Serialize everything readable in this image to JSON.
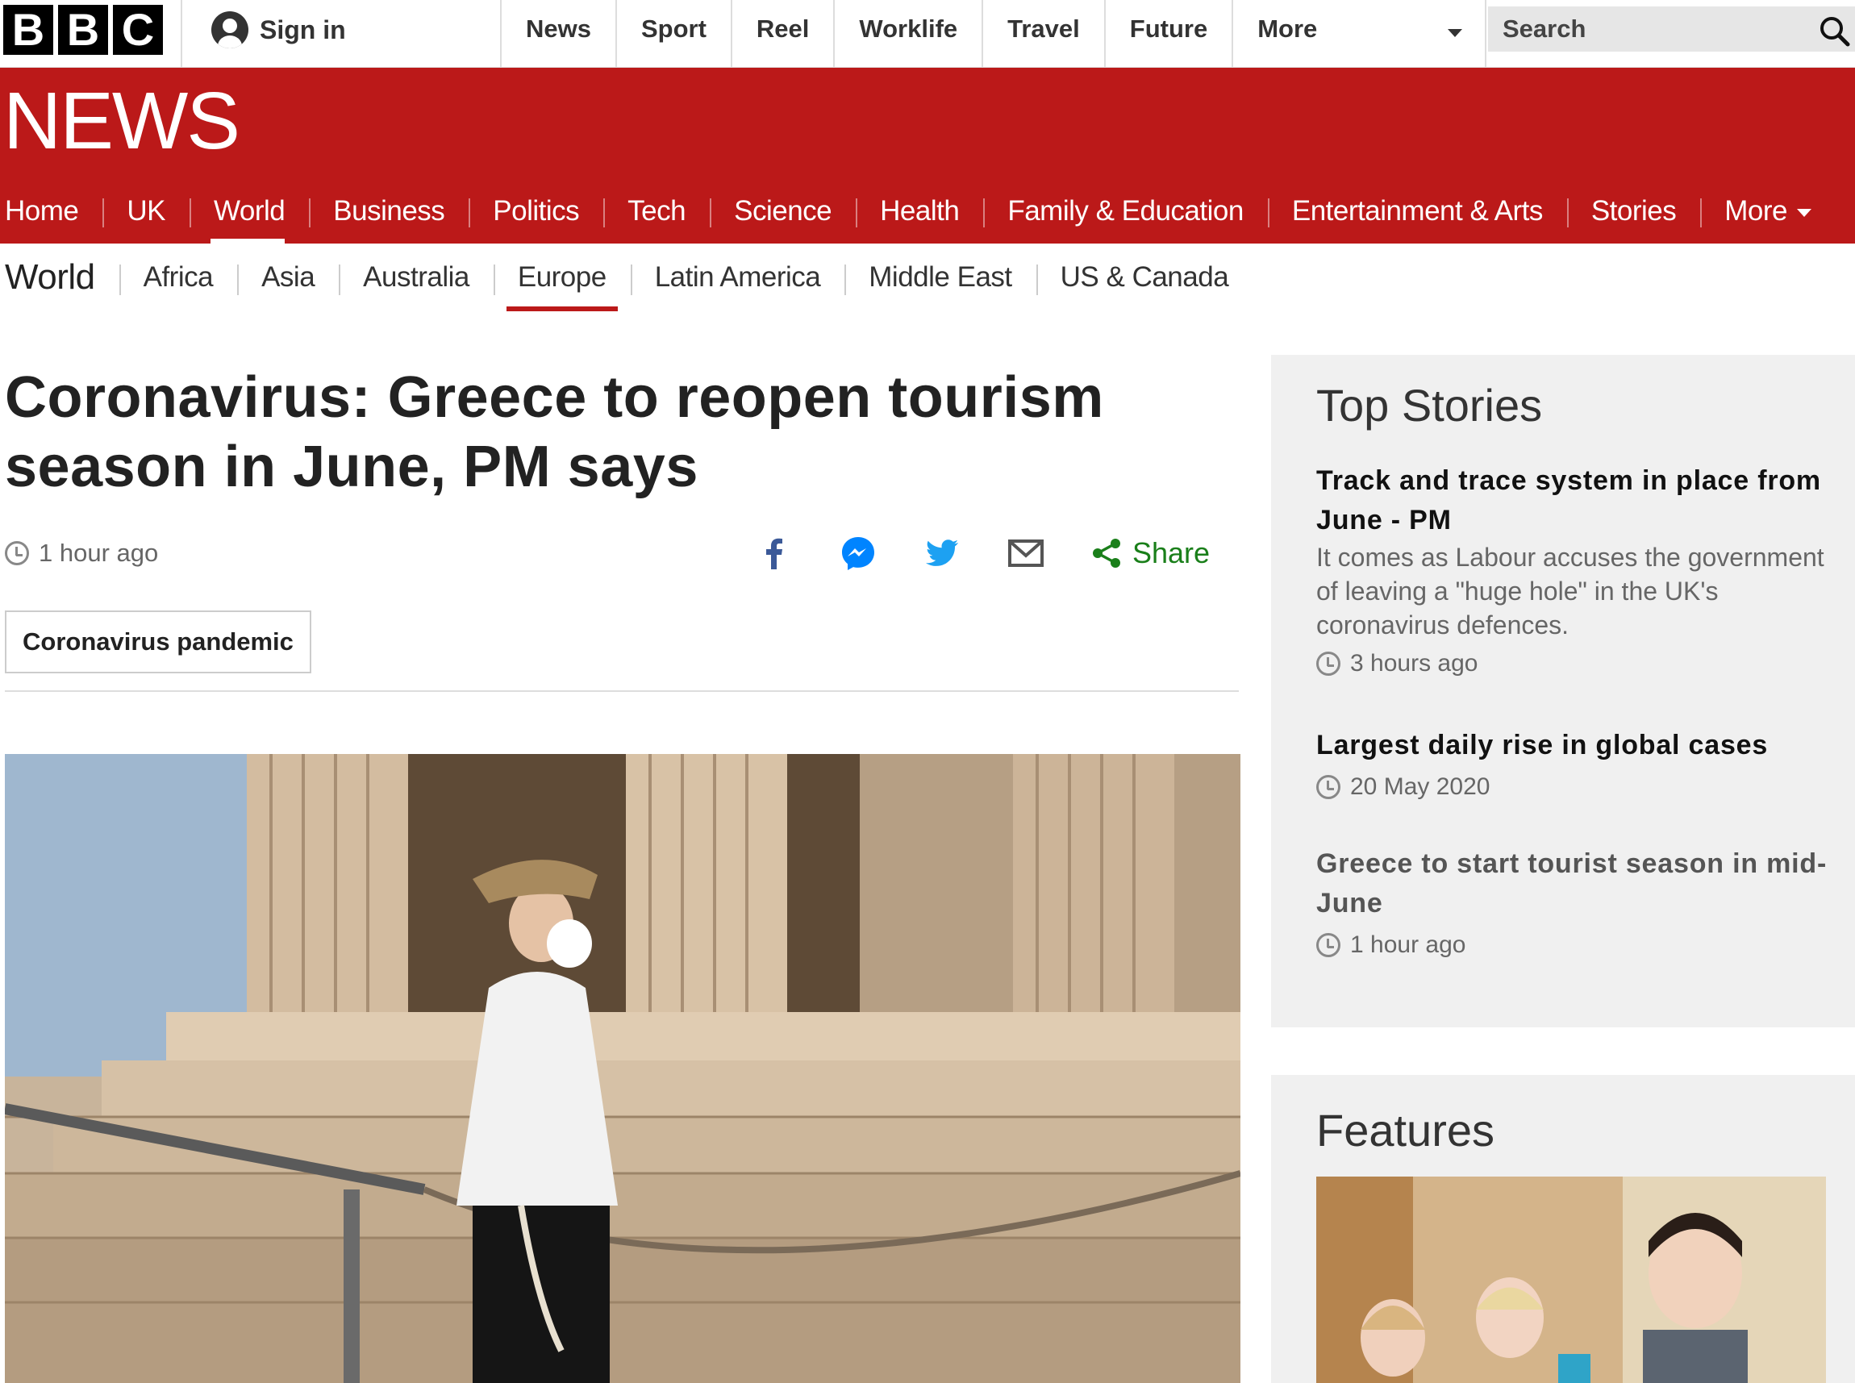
{
  "global_nav": {
    "logo_letters": [
      "B",
      "B",
      "C"
    ],
    "sign_in": "Sign in",
    "items": [
      "News",
      "Sport",
      "Reel",
      "Worklife",
      "Travel",
      "Future"
    ],
    "more": "More",
    "search_placeholder": "Search"
  },
  "news_header": {
    "title": "NEWS"
  },
  "category_nav": {
    "items": [
      "Home",
      "UK",
      "World",
      "Business",
      "Politics",
      "Tech",
      "Science",
      "Health",
      "Family & Education",
      "Entertainment & Arts",
      "Stories"
    ],
    "more": "More",
    "active": "World"
  },
  "sub_nav": {
    "title": "World",
    "items": [
      "Africa",
      "Asia",
      "Australia",
      "Europe",
      "Latin America",
      "Middle East",
      "US & Canada"
    ],
    "active": "Europe"
  },
  "article": {
    "headline": "Coronavirus: Greece to reopen tourism season in June, PM says",
    "time": "1 hour ago",
    "share_label": "Share",
    "tag": "Coronavirus pandemic",
    "share_icons": [
      "facebook-icon",
      "messenger-icon",
      "twitter-icon",
      "email-icon",
      "share-icon"
    ]
  },
  "sidebar": {
    "top_stories_title": "Top Stories",
    "stories": [
      {
        "headline": "Track and trace system in place from June - PM",
        "summary": "It comes as Labour accuses the government of leaving a \"huge hole\" in the UK's coronavirus defences.",
        "time": "3 hours ago"
      },
      {
        "headline": "Largest daily rise in global cases",
        "time": "20 May 2020"
      },
      {
        "headline": "Greece to start tourist season in mid-June",
        "time": "1 hour ago"
      }
    ],
    "features_title": "Features"
  },
  "colors": {
    "bbc_red": "#bb1919",
    "share_green": "#1a7f1a",
    "facebook_blue": "#3b5998",
    "messenger_blue": "#0084ff",
    "twitter_blue": "#1da1f2"
  }
}
